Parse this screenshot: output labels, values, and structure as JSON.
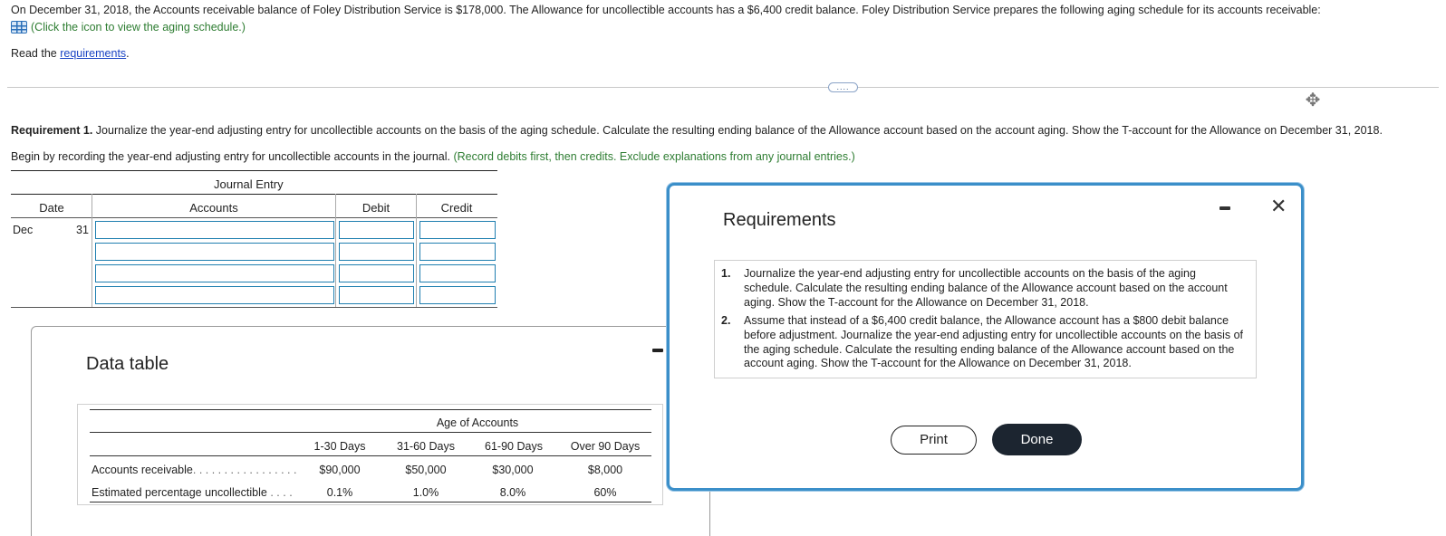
{
  "intro": {
    "line1": "On December 31, 2018, the Accounts receivable balance of Foley Distribution Service is $178,000. The Allowance for uncollectible accounts has a $6,400 credit balance. Foley Distribution Service prepares the following aging schedule for its accounts receivable:",
    "icon_link": "(Click the icon to view the aging schedule.)",
    "read_prefix": "Read the ",
    "requirements_link": "requirements",
    "read_suffix": "."
  },
  "requirement1": {
    "label": "Requirement 1.",
    "text": " Journalize the year-end adjusting entry for uncollectible accounts on the basis of the aging schedule. Calculate the resulting ending balance of the Allowance account based on the account aging. Show the T-account for the Allowance on December 31, 2018.",
    "begin": "Begin by recording the year-end adjusting entry for uncollectible accounts in the journal. ",
    "note": "(Record debits first, then credits. Exclude explanations from any journal entries.)"
  },
  "journal": {
    "caption": "Journal Entry",
    "columns": [
      "Date",
      "Accounts",
      "Debit",
      "Credit"
    ],
    "month": "Dec",
    "day": "31"
  },
  "data_table": {
    "title": "Data table",
    "header_group": "Age of Accounts",
    "columns": [
      "1-30 Days",
      "31-60 Days",
      "61-90 Days",
      "Over 90 Days"
    ],
    "rows": [
      {
        "label": "Accounts receivable",
        "dots": ". . . . . . . . . . . . . . . . .",
        "values": [
          "$90,000",
          "$50,000",
          "$30,000",
          "$8,000"
        ]
      },
      {
        "label": "Estimated percentage uncollectible",
        "dots": ". . . .",
        "values": [
          "0.1%",
          "1.0%",
          "8.0%",
          "60%"
        ]
      }
    ]
  },
  "requirements_modal": {
    "title": "Requirements",
    "items": [
      {
        "num": "1.",
        "text": "Journalize the year-end adjusting entry for uncollectible accounts on the basis of the aging schedule. Calculate the resulting ending balance of the Allowance account based on the account aging. Show the T-account for the Allowance on December 31, 2018."
      },
      {
        "num": "2.",
        "text": "Assume that instead of a $6,400 credit balance, the Allowance account has a $800 debit balance before adjustment. Journalize the year-end adjusting entry for uncollectible accounts on the basis of the aging schedule. Calculate the resulting ending balance of the Allowance account based on the account aging. Show the T-account for the Allowance on December 31, 2018."
      }
    ],
    "print_label": "Print",
    "done_label": "Done",
    "close_glyph": "✕"
  },
  "more_glyph": "....",
  "icons": {
    "grid": "table-grid-icon",
    "move": "move-icon",
    "minimize": "minimize-icon",
    "close": "close-icon"
  },
  "colors": {
    "accent_blue": "#1f7fb0",
    "link_blue": "#1a44c4",
    "note_green": "#2e7d32",
    "modal_border": "#3b8fc9",
    "done_button": "#1c2530"
  }
}
